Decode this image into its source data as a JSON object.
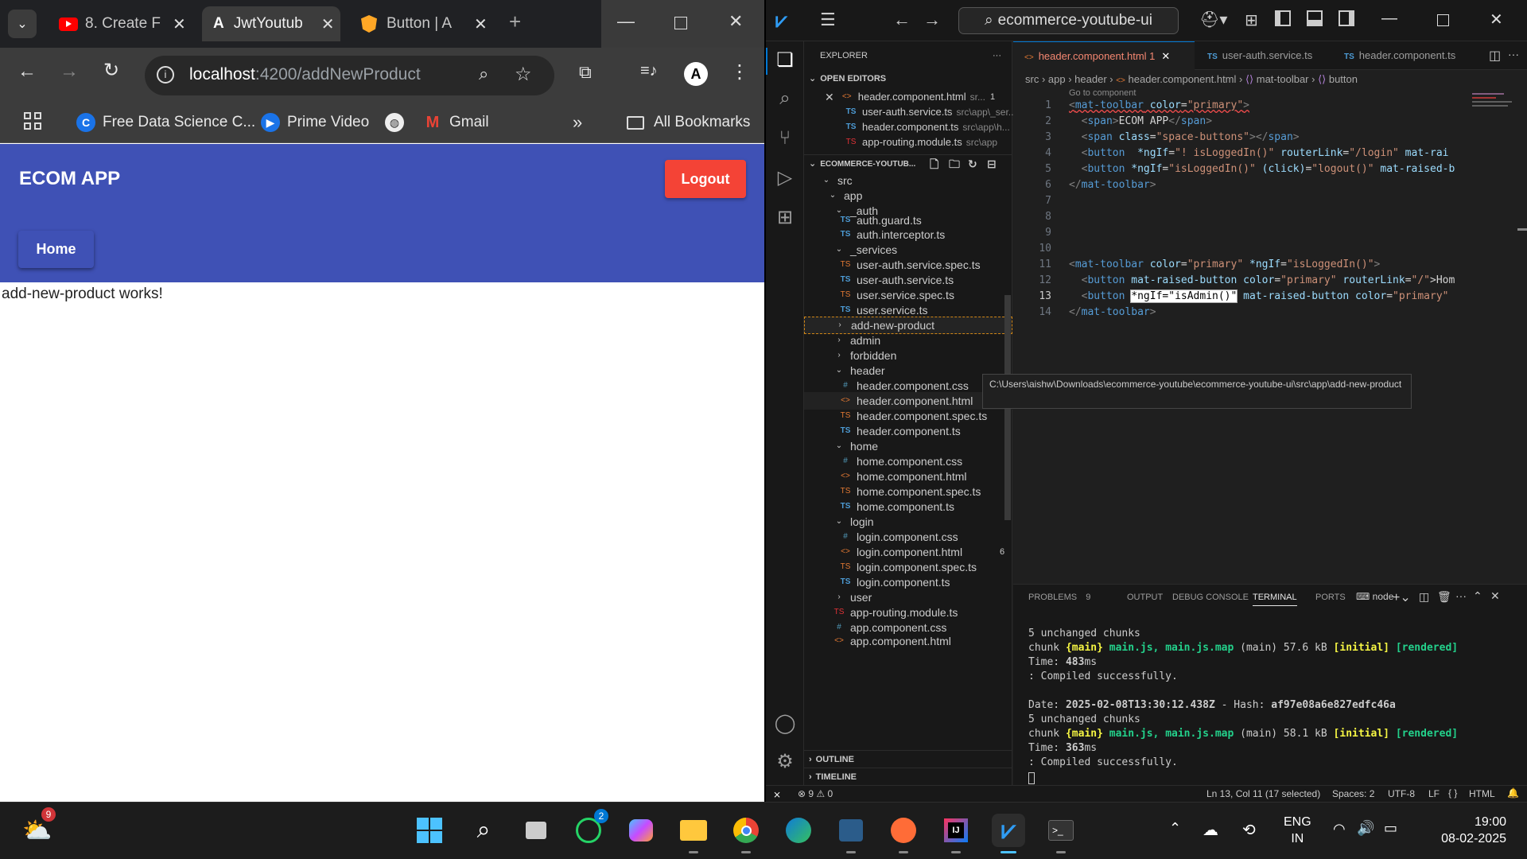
{
  "browser": {
    "tabs": [
      {
        "title": "8. Create F",
        "icon": "youtube-icon"
      },
      {
        "title": "JwtYoutub",
        "icon": "angular-icon"
      },
      {
        "title": "Button | A",
        "icon": "angular-material-icon"
      }
    ],
    "url_host": "localhost",
    "url_path": ":4200/addNewProduct",
    "bookmarks": [
      {
        "label": "Free Data Science C...",
        "icon": "c-logo-icon"
      },
      {
        "label": "Prime Video",
        "icon": "prime-video-icon"
      },
      {
        "label": "Gmail",
        "icon": "gmail-icon"
      },
      {
        "label": "All Bookmarks",
        "icon": "folder-icon"
      }
    ],
    "overflow": "»"
  },
  "app": {
    "title": "ECOM APP",
    "logout_label": "Logout",
    "home_label": "Home",
    "body_text": "add-new-product works!",
    "colors": {
      "primary": "#3f51b5",
      "warn": "#f44336"
    }
  },
  "vscode": {
    "command_center": "ecommerce-youtube-ui",
    "explorer": {
      "title": "EXPLORER",
      "open_editors_title": "OPEN EDITORS",
      "open_editors": [
        {
          "name": "header.component.html",
          "hint": "sr...",
          "badge": "1"
        },
        {
          "name": "user-auth.service.ts",
          "hint": "src\\app\\_ser..."
        },
        {
          "name": "header.component.ts",
          "hint": "src\\app\\h..."
        },
        {
          "name": "app-routing.module.ts",
          "hint": "src\\app"
        }
      ],
      "project_title": "ECOMMERCE-YOUTUB...",
      "tree": [
        {
          "name": "src",
          "type": "folder"
        },
        {
          "name": "app",
          "type": "folder"
        },
        {
          "name": "_auth",
          "type": "folder"
        },
        {
          "name": "auth.guard.ts",
          "type": "ts"
        },
        {
          "name": "auth.interceptor.ts",
          "type": "ts"
        },
        {
          "name": "_services",
          "type": "folder"
        },
        {
          "name": "user-auth.service.spec.ts",
          "type": "spec"
        },
        {
          "name": "user-auth.service.ts",
          "type": "ts"
        },
        {
          "name": "user.service.spec.ts",
          "type": "spec"
        },
        {
          "name": "user.service.ts",
          "type": "ts"
        },
        {
          "name": "add-new-product",
          "type": "folder"
        },
        {
          "name": "admin",
          "type": "folder"
        },
        {
          "name": "forbidden",
          "type": "folder"
        },
        {
          "name": "header",
          "type": "folder"
        },
        {
          "name": "header.component.css",
          "type": "css"
        },
        {
          "name": "header.component.html",
          "type": "html",
          "badge": "1"
        },
        {
          "name": "header.component.spec.ts",
          "type": "spec"
        },
        {
          "name": "header.component.ts",
          "type": "ts"
        },
        {
          "name": "home",
          "type": "folder"
        },
        {
          "name": "home.component.css",
          "type": "css"
        },
        {
          "name": "home.component.html",
          "type": "html"
        },
        {
          "name": "home.component.spec.ts",
          "type": "spec"
        },
        {
          "name": "home.component.ts",
          "type": "ts"
        },
        {
          "name": "login",
          "type": "folder"
        },
        {
          "name": "login.component.css",
          "type": "css"
        },
        {
          "name": "login.component.html",
          "type": "html",
          "badge": "6"
        },
        {
          "name": "login.component.spec.ts",
          "type": "spec"
        },
        {
          "name": "login.component.ts",
          "type": "ts"
        },
        {
          "name": "user",
          "type": "folder"
        },
        {
          "name": "app-routing.module.ts",
          "type": "ts"
        },
        {
          "name": "app.component.css",
          "type": "css"
        },
        {
          "name": "app.component.html",
          "type": "html"
        }
      ],
      "outline_title": "OUTLINE",
      "timeline_title": "TIMELINE"
    },
    "editor_tabs": [
      {
        "name": "header.component.html 1",
        "active": true
      },
      {
        "name": "user-auth.service.ts",
        "active": false
      },
      {
        "name": "header.component.ts",
        "active": false
      }
    ],
    "breadcrumb": [
      "src",
      "app",
      "header",
      "header.component.html",
      "mat-toolbar",
      "button"
    ],
    "goto_hint": "Go to component",
    "code_lines": [
      "1",
      "2",
      "3",
      "4",
      "5",
      "6",
      "7",
      "8",
      "9",
      "10",
      "11",
      "12",
      "13",
      "14"
    ],
    "code": {
      "l1": [
        "<",
        "mat-toolbar",
        " color",
        "=",
        "\"primary\"",
        ">"
      ],
      "l2": [
        "  <",
        "span",
        ">",
        "ECOM APP",
        "</",
        "span",
        ">"
      ],
      "l3": [
        "  <",
        "span",
        " class",
        "=",
        "\"space-buttons\"",
        "></",
        "span",
        ">"
      ],
      "l4": [
        "  <",
        "button",
        "  *ngIf",
        "=",
        "\"! isLoggedIn()\"",
        " routerLink",
        "=",
        "\"/login\"",
        " mat-rai"
      ],
      "l5": [
        "  <",
        "button",
        " *ngIf",
        "=",
        "\"isLoggedIn()\"",
        " (click)",
        "=",
        "\"logout()\"",
        " mat-raised-b"
      ],
      "l6": [
        "</",
        "mat-toolbar",
        ">"
      ],
      "l11": [
        "<",
        "mat-toolbar",
        " color",
        "=",
        "\"primary\"",
        " *ngIf",
        "=",
        "\"isLoggedIn()\"",
        ">"
      ],
      "l12": [
        "  <",
        "button",
        " mat-raised-button",
        " color",
        "=",
        "\"primary\"",
        " routerLink",
        "=",
        "\"/\"",
        ">Hom"
      ],
      "l13": [
        "  <",
        "button",
        " ",
        "*ngIf=\"isAdmin()\"",
        " mat-raised-button",
        " color",
        "=",
        "\"primary\""
      ],
      "l14": [
        "</",
        "mat-toolbar",
        ">"
      ]
    },
    "tooltip": "C:\\Users\\aishw\\Downloads\\ecommerce-youtube\\ecommerce-youtube-ui\\src\\app\\add-new-product",
    "panel_tabs": [
      "PROBLEMS",
      "9",
      "OUTPUT",
      "DEBUG CONSOLE",
      "TERMINAL",
      "PORTS"
    ],
    "terminal_name": "node",
    "terminal": {
      "t1": "5 unchanged chunks",
      "t2": [
        "chunk ",
        "{main}",
        " main.js, main.js.map",
        " (main) 57.6 kB ",
        "[initial]",
        " ",
        "[rendered]"
      ],
      "t3": [
        "Time: ",
        "483",
        "ms"
      ],
      "t4": ": Compiled successfully.",
      "t5": [
        "Date: ",
        "2025-02-08T13:30:12.438Z",
        " - Hash: ",
        "af97e08a6e827edfc46a"
      ],
      "t6": "5 unchanged chunks",
      "t7": [
        "chunk ",
        "{main}",
        " main.js, main.js.map",
        " (main) 58.1 kB ",
        "[initial]",
        " ",
        "[rendered]"
      ],
      "t8": [
        "Time: ",
        "363",
        "ms"
      ],
      "t9": ": Compiled successfully."
    },
    "status": {
      "problems": "⊗ 9 ⚠ 0",
      "cursor": "Ln 13, Col 11 (17 selected)",
      "spaces": "Spaces: 2",
      "encoding": "UTF-8",
      "eol": "LF",
      "language": "HTML"
    }
  },
  "taskbar": {
    "weather_badge": "9",
    "whatsapp_badge": "2",
    "lang": [
      "ENG",
      "IN"
    ],
    "time": "19:00",
    "date": "08-02-2025"
  }
}
